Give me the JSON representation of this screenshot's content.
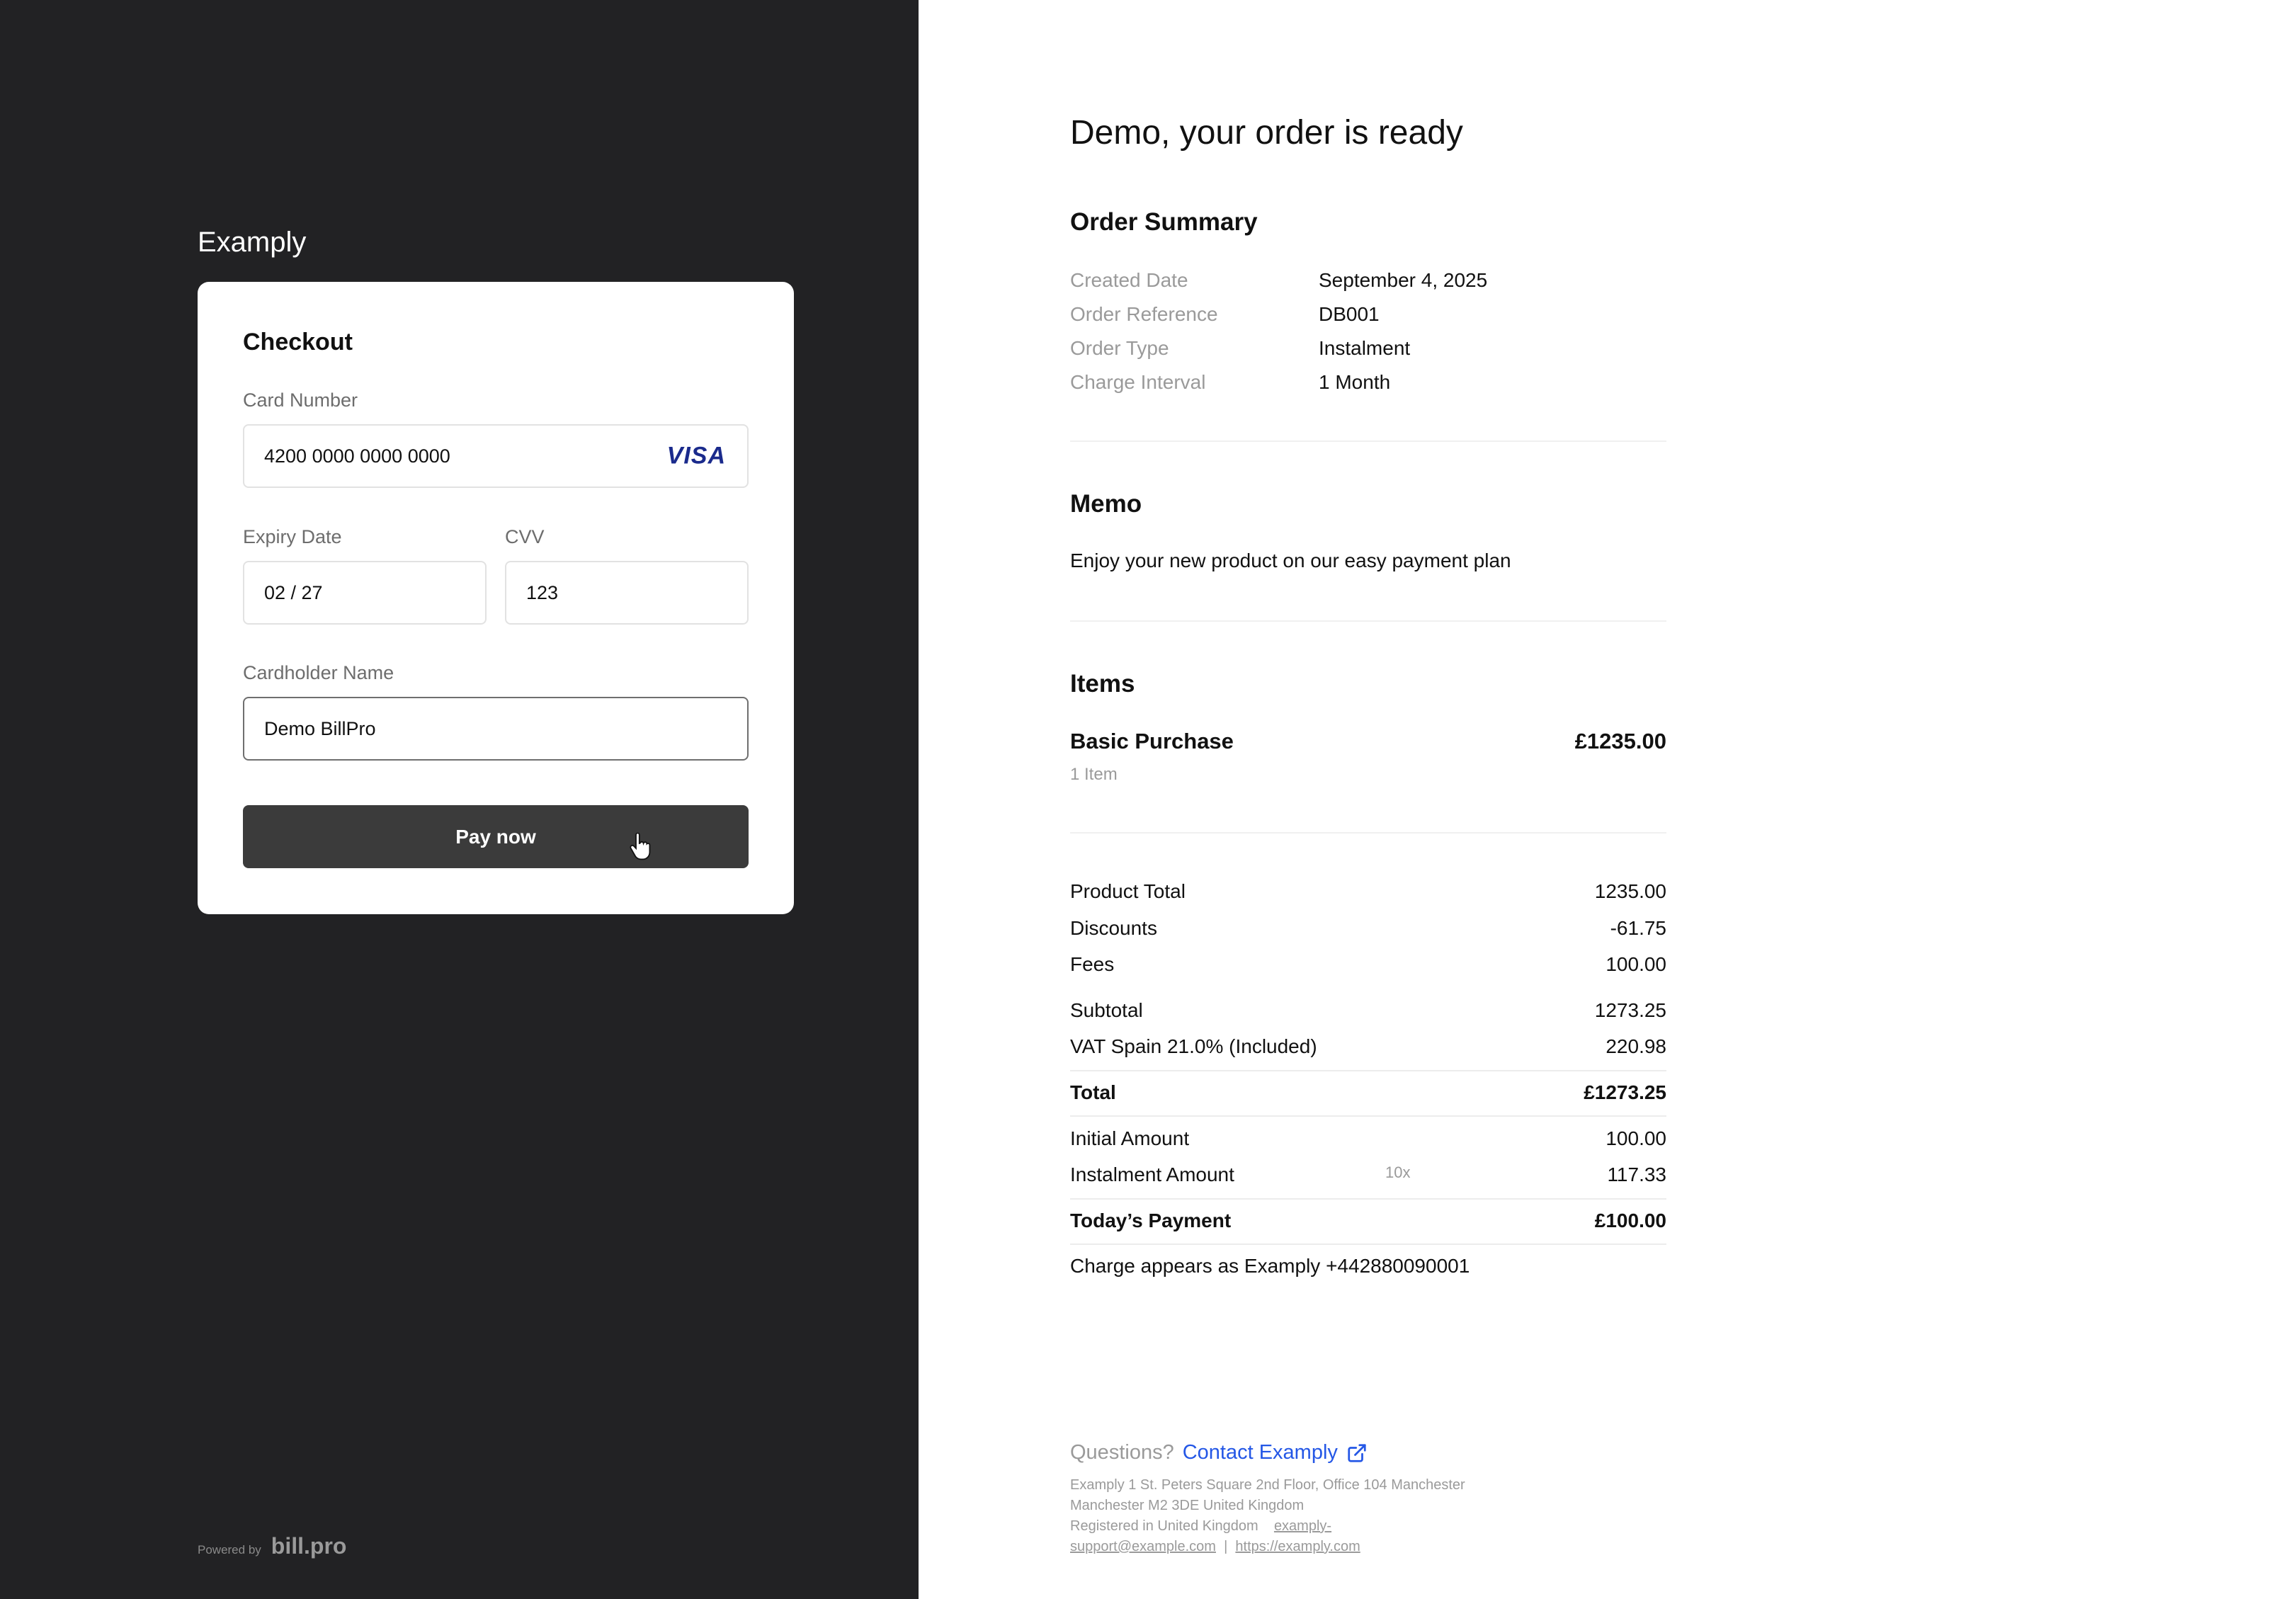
{
  "left": {
    "brand": "Examply",
    "checkout": {
      "title": "Checkout",
      "card_number_label": "Card Number",
      "card_number": "4200 0000 0000 0000",
      "card_brand": "VISA",
      "expiry_label": "Expiry Date",
      "expiry": "02 / 27",
      "cvv_label": "CVV",
      "cvv": "123",
      "cardholder_label": "Cardholder Name",
      "cardholder": "Demo BillPro",
      "pay_label": "Pay now"
    },
    "powered_by": {
      "text": "Powered by",
      "logo": "bill.pro"
    }
  },
  "right": {
    "heading": "Demo, your order is ready",
    "order_summary": {
      "title": "Order Summary",
      "rows": [
        {
          "label": "Created Date",
          "value": "September 4, 2025"
        },
        {
          "label": "Order Reference",
          "value": "DB001"
        },
        {
          "label": "Order Type",
          "value": "Instalment"
        },
        {
          "label": "Charge Interval",
          "value": "1 Month"
        }
      ]
    },
    "memo": {
      "title": "Memo",
      "text": "Enjoy your new product on our easy payment plan"
    },
    "items": {
      "title": "Items",
      "list": [
        {
          "name": "Basic Purchase",
          "price": "£1235.00",
          "qty": "1 Item"
        }
      ]
    },
    "totals": {
      "product_total": {
        "label": "Product Total",
        "value": "1235.00"
      },
      "discounts": {
        "label": "Discounts",
        "value": "-61.75"
      },
      "fees": {
        "label": "Fees",
        "value": "100.00"
      },
      "subtotal": {
        "label": "Subtotal",
        "value": "1273.25"
      },
      "vat": {
        "label": "VAT Spain 21.0% (Included)",
        "value": "220.98"
      },
      "total": {
        "label": "Total",
        "value": "£1273.25"
      },
      "initial": {
        "label": "Initial Amount",
        "value": "100.00"
      },
      "instalment": {
        "label": "Instalment Amount",
        "multiplier": "10x",
        "value": "117.33"
      },
      "today": {
        "label": "Today’s Payment",
        "value": "£100.00"
      }
    },
    "charge_note": "Charge appears as Examply +442880090001",
    "questions": {
      "prefix": "Questions?",
      "link": "Contact Examply"
    },
    "footer": {
      "address1": "Examply 1 St. Peters Square 2nd Floor, Office 104 Manchester",
      "address2": "Manchester M2 3DE United Kingdom",
      "registered": "Registered in United Kingdom",
      "email_part1": "examply-",
      "email_part2": "support@example.com",
      "separator": "|",
      "website": "https://examply.com"
    }
  },
  "colors": {
    "left_bg": "#222224",
    "button_bg": "#3b3b3b",
    "link": "#2457e6",
    "visa": "#1a2a8c"
  },
  "icons": {
    "cursor": "hand-pointer-icon",
    "external": "external-link-icon"
  }
}
